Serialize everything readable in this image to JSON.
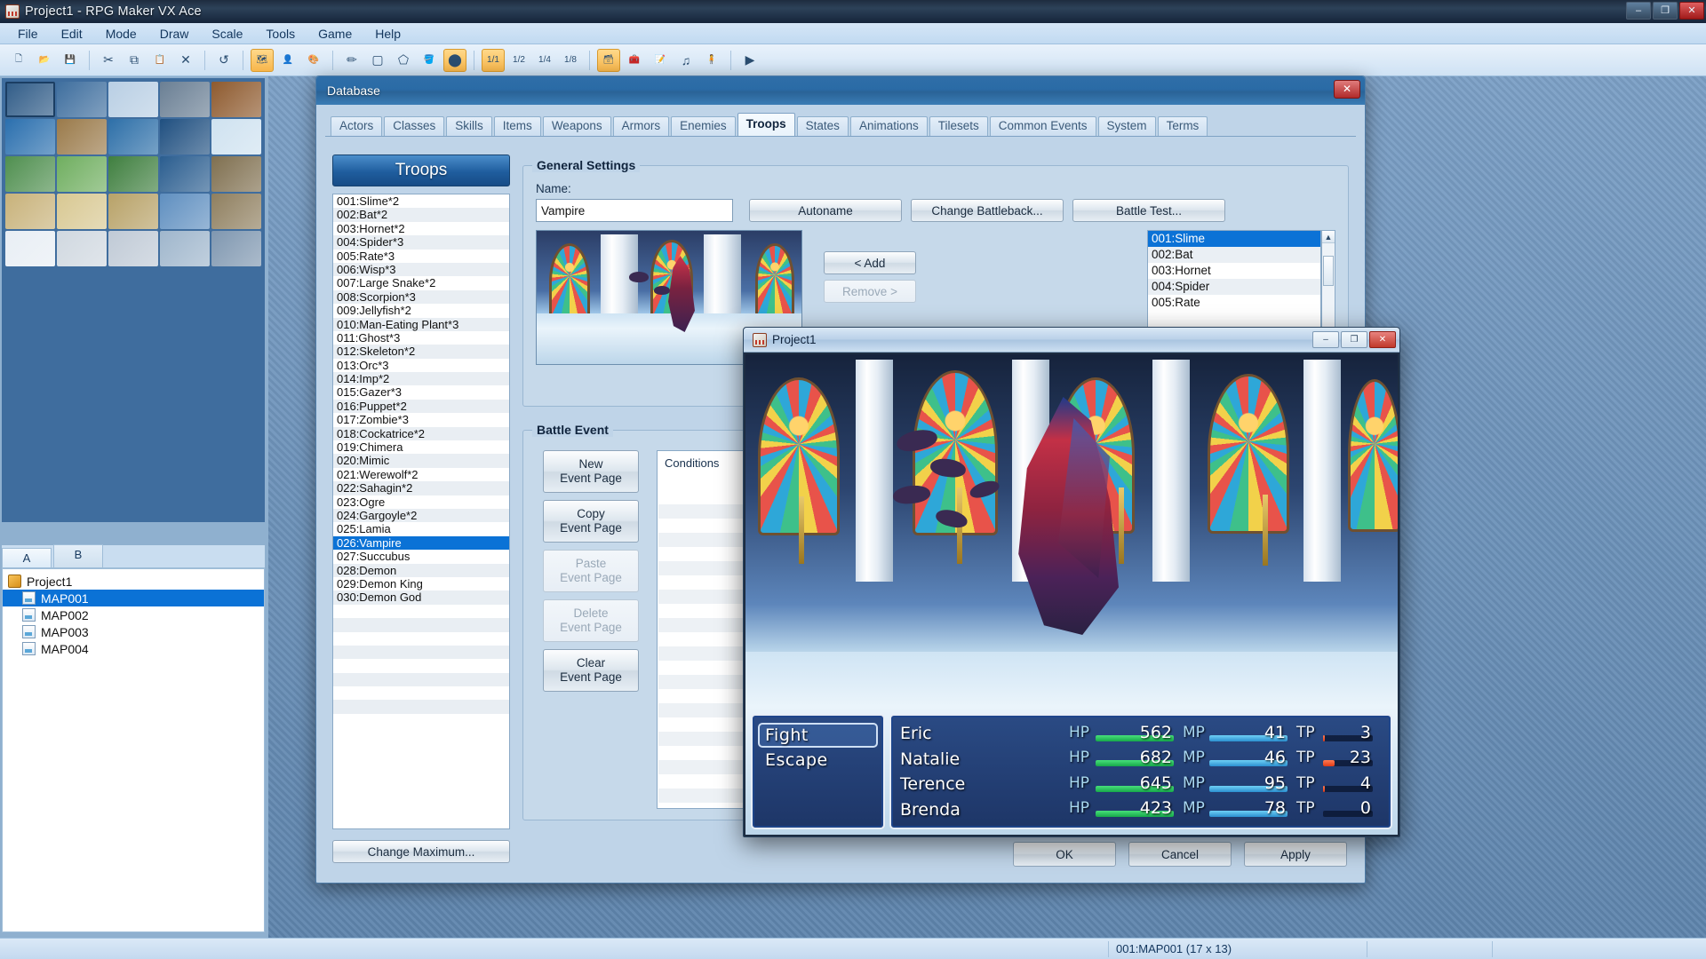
{
  "app": {
    "title": "Project1 - RPG Maker VX Ace",
    "window_buttons": [
      "–",
      "❐",
      "✕"
    ]
  },
  "menu": [
    "File",
    "Edit",
    "Mode",
    "Draw",
    "Scale",
    "Tools",
    "Game",
    "Help"
  ],
  "toolbar": [
    {
      "name": "new-project-icon",
      "glyph": "🗋"
    },
    {
      "name": "open-project-icon",
      "glyph": "📂"
    },
    {
      "name": "save-project-icon",
      "glyph": "💾"
    },
    {
      "name": "separator",
      "glyph": ""
    },
    {
      "name": "cut-icon",
      "glyph": "✂"
    },
    {
      "name": "copy-icon",
      "glyph": "⧉"
    },
    {
      "name": "paste-icon",
      "glyph": "📋"
    },
    {
      "name": "delete-icon",
      "glyph": "✕"
    },
    {
      "name": "separator",
      "glyph": ""
    },
    {
      "name": "undo-icon",
      "glyph": "↺"
    },
    {
      "name": "separator",
      "glyph": ""
    },
    {
      "name": "map-mode-icon",
      "glyph": "🗺"
    },
    {
      "name": "event-mode-icon",
      "glyph": "👤"
    },
    {
      "name": "region-mode-icon",
      "glyph": "🎨"
    },
    {
      "name": "separator",
      "glyph": ""
    },
    {
      "name": "pencil-tool-icon",
      "glyph": "✏"
    },
    {
      "name": "rectangle-tool-icon",
      "glyph": "▢"
    },
    {
      "name": "ellipse-tool-icon",
      "glyph": "⬠"
    },
    {
      "name": "flood-fill-tool-icon",
      "glyph": "🪣"
    },
    {
      "name": "shadow-pen-tool-icon",
      "glyph": "⬤"
    },
    {
      "name": "separator",
      "glyph": ""
    },
    {
      "name": "zoom-1-1-icon",
      "glyph": "1/1"
    },
    {
      "name": "zoom-1-2-icon",
      "glyph": "1/2"
    },
    {
      "name": "zoom-1-4-icon",
      "glyph": "1/4"
    },
    {
      "name": "zoom-1-8-icon",
      "glyph": "1/8"
    },
    {
      "name": "separator",
      "glyph": ""
    },
    {
      "name": "database-icon",
      "glyph": "🗃"
    },
    {
      "name": "resource-manager-icon",
      "glyph": "🧰"
    },
    {
      "name": "script-editor-icon",
      "glyph": "📝"
    },
    {
      "name": "sound-test-icon",
      "glyph": "♫"
    },
    {
      "name": "character-generator-icon",
      "glyph": "🧍"
    },
    {
      "name": "separator",
      "glyph": ""
    },
    {
      "name": "playtest-icon",
      "glyph": "▶"
    }
  ],
  "left_panel": {
    "layer_tabs": [
      {
        "label": "A",
        "selected": false
      },
      {
        "label": "B",
        "selected": true
      }
    ],
    "map_tree": [
      {
        "label": "Project1",
        "kind": "project",
        "selected": false
      },
      {
        "label": "MAP001",
        "kind": "map",
        "selected": true
      },
      {
        "label": "MAP002",
        "kind": "map",
        "selected": false
      },
      {
        "label": "MAP003",
        "kind": "map",
        "selected": false
      },
      {
        "label": "MAP004",
        "kind": "map",
        "selected": false
      }
    ]
  },
  "status_bar": {
    "map_info": "001:MAP001 (17 x 13)",
    "cells": [
      "",
      ""
    ]
  },
  "database": {
    "title": "Database",
    "close_label": "✕",
    "tabs": [
      {
        "label": "Actors",
        "selected": false
      },
      {
        "label": "Classes",
        "selected": false
      },
      {
        "label": "Skills",
        "selected": false
      },
      {
        "label": "Items",
        "selected": false
      },
      {
        "label": "Weapons",
        "selected": false
      },
      {
        "label": "Armors",
        "selected": false
      },
      {
        "label": "Enemies",
        "selected": false
      },
      {
        "label": "Troops",
        "selected": true
      },
      {
        "label": "States",
        "selected": false
      },
      {
        "label": "Animations",
        "selected": false
      },
      {
        "label": "Tilesets",
        "selected": false
      },
      {
        "label": "Common Events",
        "selected": false
      },
      {
        "label": "System",
        "selected": false
      },
      {
        "label": "Terms",
        "selected": false
      }
    ],
    "troops_panel": {
      "header": "Troops",
      "change_maximum_label": "Change Maximum...",
      "items": [
        {
          "label": "001:Slime*2",
          "selected": false
        },
        {
          "label": "002:Bat*2",
          "selected": false
        },
        {
          "label": "003:Hornet*2",
          "selected": false
        },
        {
          "label": "004:Spider*3",
          "selected": false
        },
        {
          "label": "005:Rate*3",
          "selected": false
        },
        {
          "label": "006:Wisp*3",
          "selected": false
        },
        {
          "label": "007:Large Snake*2",
          "selected": false
        },
        {
          "label": "008:Scorpion*3",
          "selected": false
        },
        {
          "label": "009:Jellyfish*2",
          "selected": false
        },
        {
          "label": "010:Man-Eating Plant*3",
          "selected": false
        },
        {
          "label": "011:Ghost*3",
          "selected": false
        },
        {
          "label": "012:Skeleton*2",
          "selected": false
        },
        {
          "label": "013:Orc*3",
          "selected": false
        },
        {
          "label": "014:Imp*2",
          "selected": false
        },
        {
          "label": "015:Gazer*3",
          "selected": false
        },
        {
          "label": "016:Puppet*2",
          "selected": false
        },
        {
          "label": "017:Zombie*3",
          "selected": false
        },
        {
          "label": "018:Cockatrice*2",
          "selected": false
        },
        {
          "label": "019:Chimera",
          "selected": false
        },
        {
          "label": "020:Mimic",
          "selected": false
        },
        {
          "label": "021:Werewolf*2",
          "selected": false
        },
        {
          "label": "022:Sahagin*2",
          "selected": false
        },
        {
          "label": "023:Ogre",
          "selected": false
        },
        {
          "label": "024:Gargoyle*2",
          "selected": false
        },
        {
          "label": "025:Lamia",
          "selected": false
        },
        {
          "label": "026:Vampire",
          "selected": true
        },
        {
          "label": "027:Succubus",
          "selected": false
        },
        {
          "label": "028:Demon",
          "selected": false
        },
        {
          "label": "029:Demon King",
          "selected": false
        },
        {
          "label": "030:Demon God",
          "selected": false
        },
        {
          "label": "",
          "selected": false
        },
        {
          "label": "",
          "selected": false
        },
        {
          "label": "",
          "selected": false
        },
        {
          "label": "",
          "selected": false
        },
        {
          "label": "",
          "selected": false
        },
        {
          "label": "",
          "selected": false
        },
        {
          "label": "",
          "selected": false
        },
        {
          "label": "",
          "selected": false
        }
      ]
    },
    "general_settings": {
      "title": "General Settings",
      "name_label": "Name:",
      "name_value": "Vampire",
      "autoname_label": "Autoname",
      "change_battleback_label": "Change Battleback...",
      "battle_test_label": "Battle Test...",
      "add_label": "< Add",
      "remove_label": "Remove >",
      "enemy_list": [
        {
          "label": "001:Slime",
          "selected": true
        },
        {
          "label": "002:Bat",
          "selected": false
        },
        {
          "label": "003:Hornet",
          "selected": false
        },
        {
          "label": "004:Spider",
          "selected": false
        },
        {
          "label": "005:Rate",
          "selected": false
        }
      ],
      "scroll_up": "▲",
      "scroll_down": "▼"
    },
    "battle_event": {
      "title": "Battle Event",
      "buttons": [
        {
          "label": "New\nEvent Page",
          "disabled": false
        },
        {
          "label": "Copy\nEvent Page",
          "disabled": false
        },
        {
          "label": "Paste\nEvent Page",
          "disabled": true
        },
        {
          "label": "Delete\nEvent Page",
          "disabled": true
        },
        {
          "label": "Clear\nEvent Page",
          "disabled": false
        }
      ],
      "conditions_label": "Conditions"
    },
    "footer_buttons": [
      {
        "label": "OK"
      },
      {
        "label": "Cancel"
      },
      {
        "label": "Apply"
      }
    ]
  },
  "game_window": {
    "title": "Project1",
    "buttons": [
      "–",
      "❐",
      "✕"
    ],
    "party_commands": [
      {
        "label": "Fight",
        "selected": true
      },
      {
        "label": "Escape",
        "selected": false
      }
    ],
    "party": [
      {
        "name": "Eric",
        "hp_label": "HP",
        "hp": "562",
        "hp_pct": 100,
        "mp_label": "MP",
        "mp": "41",
        "mp_pct": 100,
        "tp_label": "TP",
        "tp": "3",
        "tp_pct": 3
      },
      {
        "name": "Natalie",
        "hp_label": "HP",
        "hp": "682",
        "hp_pct": 100,
        "mp_label": "MP",
        "mp": "46",
        "mp_pct": 100,
        "tp_label": "TP",
        "tp": "23",
        "tp_pct": 23
      },
      {
        "name": "Terence",
        "hp_label": "HP",
        "hp": "645",
        "hp_pct": 100,
        "mp_label": "MP",
        "mp": "95",
        "mp_pct": 100,
        "tp_label": "TP",
        "tp": "4",
        "tp_pct": 4
      },
      {
        "name": "Brenda",
        "hp_label": "HP",
        "hp": "423",
        "hp_pct": 100,
        "mp_label": "MP",
        "mp": "78",
        "mp_pct": 100,
        "tp_label": "TP",
        "tp": "0",
        "tp_pct": 0
      }
    ]
  },
  "colors": {
    "accent": "#0b72d6",
    "title_blue": "#2a6ba6",
    "hp_green": "#16a84a",
    "mp_blue": "#2b8fd0",
    "tp_orange": "#e03a17"
  }
}
